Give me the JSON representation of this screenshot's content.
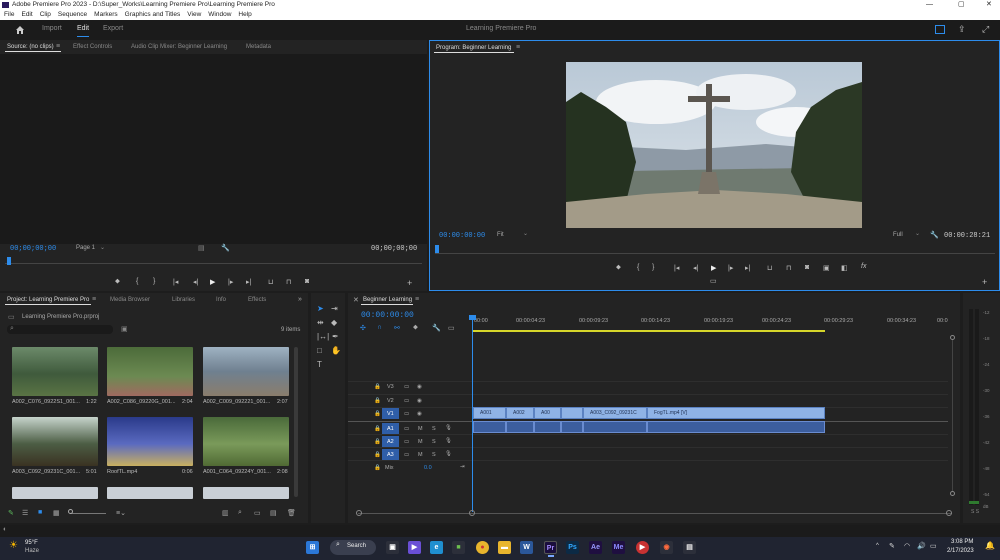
{
  "window": {
    "title": "Adobe Premiere Pro 2023 - D:\\Super_Works\\Learning Premiere Pro\\Learning Premiere Pro",
    "minimize": "—",
    "maximize": "▢",
    "close": "✕"
  },
  "menu": [
    "File",
    "Edit",
    "Clip",
    "Sequence",
    "Markers",
    "Graphics and Titles",
    "View",
    "Window",
    "Help"
  ],
  "header": {
    "tabs": [
      "Import",
      "Edit",
      "Export"
    ],
    "active_tab": "Edit",
    "project_title": "Learning Premiere Pro"
  },
  "source_panel": {
    "tabs": [
      "Source: (no clips)",
      "Effect Controls",
      "Audio Clip Mixer: Beginner Learning",
      "Metadata"
    ],
    "timecode_left": "00;00;00;00",
    "page": "Page 1",
    "timecode_right": "00;00;00;00"
  },
  "program_panel": {
    "tab": "Program: Beginner Learning",
    "timecode": "00:00:00:00",
    "fit": "Fit",
    "quality": "Full",
    "duration": "00:00:28:21"
  },
  "project_panel": {
    "tabs": [
      "Project: Learning Premiere Pro",
      "Media Browser",
      "Libraries",
      "Info",
      "Effects"
    ],
    "path": "Learning Premiere Pro.prproj",
    "item_count": "9 items",
    "items": [
      {
        "name": "A002_C076_0922S1_001...",
        "dur": "1:22"
      },
      {
        "name": "A002_C086_09220G_001...",
        "dur": "2:04"
      },
      {
        "name": "A002_C009_092221_001...",
        "dur": "2:07"
      },
      {
        "name": "A003_C092_09231C_001...",
        "dur": "5:01"
      },
      {
        "name": "RoofTL.mp4",
        "dur": "0:06"
      },
      {
        "name": "A001_C064_09224Y_001...",
        "dur": "2:08"
      }
    ]
  },
  "timeline": {
    "tab": "Beginner Learning",
    "timecode": "00:00:00:00",
    "ruler": [
      "00:00",
      "00:00:04:23",
      "00:00:09:23",
      "00:00:14:23",
      "00:00:19:23",
      "00:00:24:23",
      "00:00:29:23",
      "00:00:34:23",
      "00:0"
    ],
    "video_tracks": [
      "V3",
      "V2",
      "V1"
    ],
    "audio_tracks": [
      "A1",
      "A2",
      "A3"
    ],
    "mix_label": "Mix",
    "mix_value": "0.0",
    "v1_clips": [
      "A001",
      "A002",
      "A00",
      "",
      "A003_C092_09231C",
      "FogTL.mp4 [V]"
    ]
  },
  "meters": {
    "ticks": [
      "-12",
      "-18",
      "-24",
      "-30",
      "-36",
      "-42",
      "-48",
      "-54",
      "dB"
    ],
    "solo": "S S"
  },
  "taskbar": {
    "weather_temp": "95°F",
    "weather_desc": "Haze",
    "search": "Search",
    "time": "3:08 PM",
    "date": "2/17/2023"
  }
}
